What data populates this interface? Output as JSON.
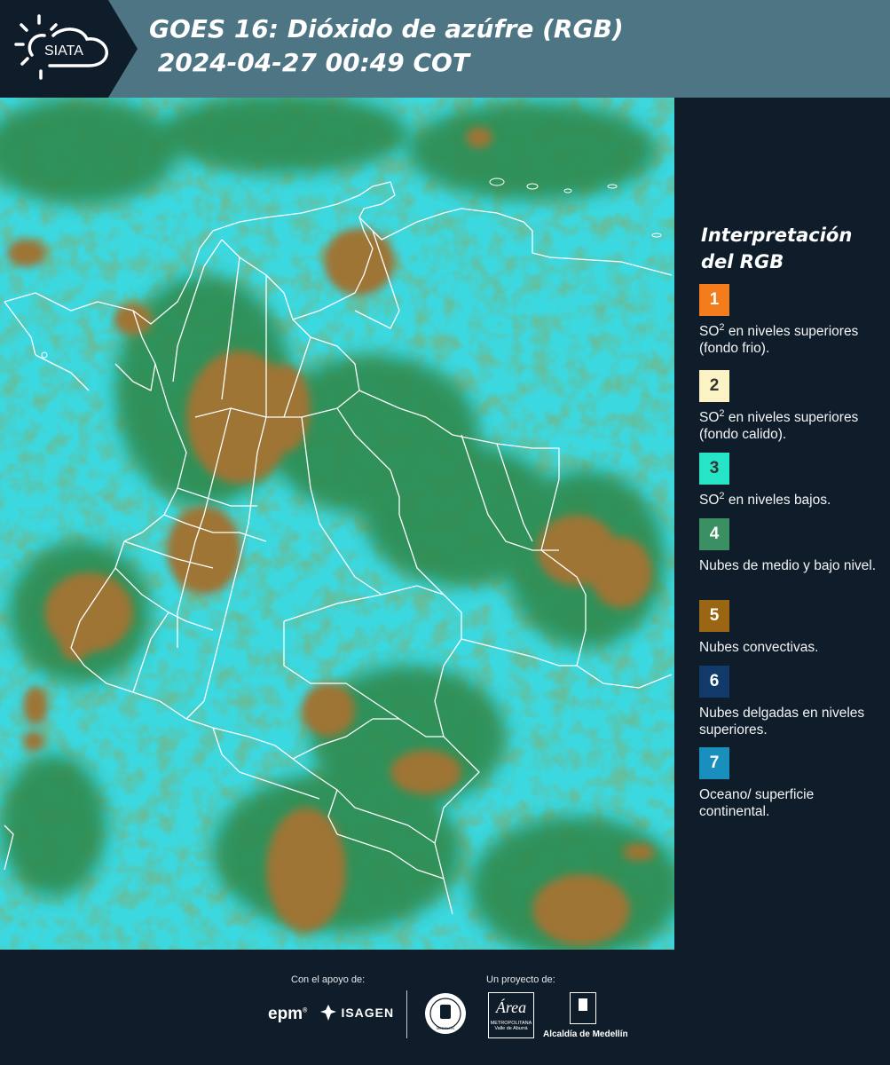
{
  "header": {
    "logo_text": "SIATA",
    "title_line1": "GOES 16: Dióxido de azúfre (RGB)",
    "title_line2": " 2024-04-27 00:49 COT"
  },
  "map": {
    "description_icon": "satellite-rgb-map",
    "colors": {
      "background": "#38d6df",
      "mid_low_clouds": "#2f8a4e",
      "convective": "#9e7434",
      "borders": "#ffffff"
    }
  },
  "legend": {
    "title_line1": "Interpretación",
    "title_line2": "del RGB",
    "items": [
      {
        "number": "1",
        "color": "#f37d1c",
        "text_color": "#ffffff",
        "pre": "SO",
        "sup": "2",
        "post": " en niveles superiores (fondo frio)."
      },
      {
        "number": "2",
        "color": "#fcf3c4",
        "text_color": "#333333",
        "pre": "SO",
        "sup": "2",
        "post": " en niveles superiores (fondo calido)."
      },
      {
        "number": "3",
        "color": "#26e5c7",
        "text_color": "#333333",
        "pre": "SO",
        "sup": "2",
        "post": " en niveles bajos."
      },
      {
        "number": "4",
        "color": "#3a9063",
        "text_color": "#ffffff",
        "pre": "Nubes de medio y bajo nivel.",
        "sup": "",
        "post": ""
      },
      {
        "number": "5",
        "color": "#9a6614",
        "text_color": "#ffffff",
        "pre": "Nubes convectivas.",
        "sup": "",
        "post": ""
      },
      {
        "number": "6",
        "color": "#113a6a",
        "text_color": "#ffffff",
        "pre": "Nubes delgadas en niveles superiores.",
        "sup": "",
        "post": ""
      },
      {
        "number": "7",
        "color": "#1a8ebd",
        "text_color": "#ffffff",
        "pre": "Oceano/ superficie continental.",
        "sup": "",
        "post": ""
      }
    ]
  },
  "footer": {
    "support_label": "Con el apoyo de:",
    "project_label": "Un proyecto de:",
    "epm": "epm",
    "isagen": "ISAGEN",
    "area_logo": "Área",
    "area_sub1": "METROPOLITANA",
    "area_sub2": "Valle de Aburrá",
    "alcaldia": "Alcaldía de Medellín",
    "seal_text": "MEDELLÍN"
  }
}
